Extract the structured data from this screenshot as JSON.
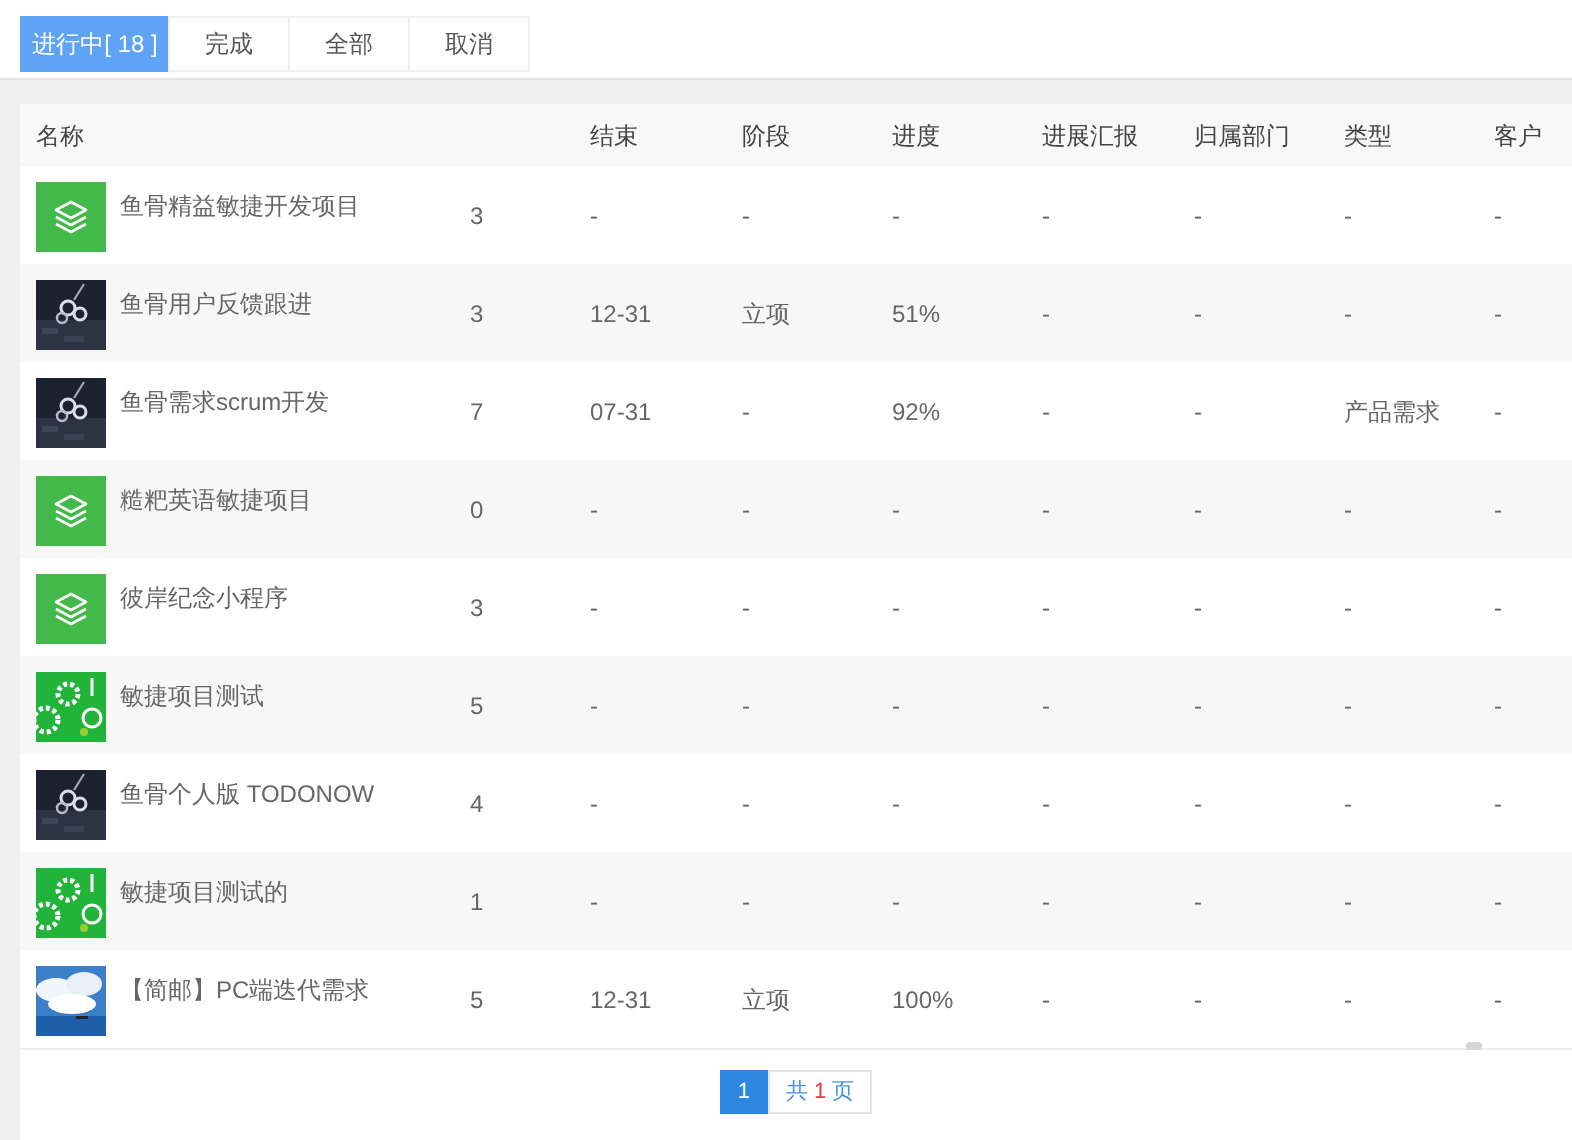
{
  "tabs": [
    {
      "label": "进行中[ 18 ]",
      "selected": true
    },
    {
      "label": "完成",
      "selected": false
    },
    {
      "label": "全部",
      "selected": false
    },
    {
      "label": "取消",
      "selected": false
    }
  ],
  "table": {
    "columns": [
      "名称",
      "",
      "结束",
      "阶段",
      "进度",
      "进展汇报",
      "归属部门",
      "类型",
      "客户"
    ],
    "rows": [
      {
        "kind": "layers",
        "cells": [
          "鱼骨精益敏捷开发项目",
          "3",
          "-",
          "-",
          "-",
          "-",
          "-",
          "-",
          "-"
        ]
      },
      {
        "kind": "night",
        "cells": [
          "鱼骨用户反馈跟进",
          "3",
          "12-31",
          "立项",
          "51%",
          "-",
          "-",
          "-",
          "-"
        ]
      },
      {
        "kind": "night",
        "cells": [
          "鱼骨需求scrum开发",
          "7",
          "07-31",
          "-",
          "92%",
          "-",
          "-",
          "产品需求",
          "-"
        ]
      },
      {
        "kind": "layers",
        "cells": [
          "糙粑英语敏捷项目",
          "0",
          "-",
          "-",
          "-",
          "-",
          "-",
          "-",
          "-"
        ]
      },
      {
        "kind": "layers",
        "cells": [
          "彼岸纪念小程序",
          "3",
          "-",
          "-",
          "-",
          "-",
          "-",
          "-",
          "-"
        ]
      },
      {
        "kind": "gears",
        "cells": [
          "敏捷项目测试",
          "5",
          "-",
          "-",
          "-",
          "-",
          "-",
          "-",
          "-"
        ]
      },
      {
        "kind": "night",
        "cells": [
          "鱼骨个人版 TODONOW",
          "4",
          "-",
          "-",
          "-",
          "-",
          "-",
          "-",
          "-"
        ]
      },
      {
        "kind": "gears",
        "cells": [
          "敏捷项目测试的",
          "1",
          "-",
          "-",
          "-",
          "-",
          "-",
          "-",
          "-"
        ]
      },
      {
        "kind": "sky",
        "cells": [
          "【简邮】PC端迭代需求",
          "5",
          "12-31",
          "立项",
          "100%",
          "-",
          "-",
          "-",
          "-"
        ]
      }
    ]
  },
  "pager": {
    "pages": [
      {
        "label": "1",
        "selected": true
      }
    ],
    "total_prefix": "共",
    "total_count": "1",
    "total_suffix": "页"
  }
}
